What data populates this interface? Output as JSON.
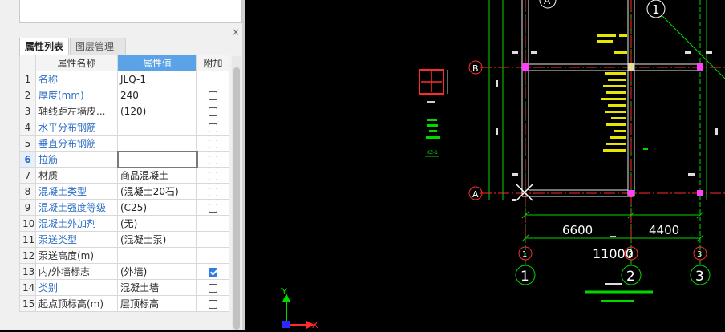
{
  "panel": {
    "close_icon": "×",
    "tabs": [
      {
        "label": "属性列表",
        "active": true
      },
      {
        "label": "图层管理",
        "active": false
      }
    ]
  },
  "table": {
    "headers": {
      "name": "属性名称",
      "value": "属性值",
      "extra": "附加"
    },
    "rows": [
      {
        "num": "1",
        "name": "名称",
        "value": "JLQ-1",
        "blue": true,
        "check": null
      },
      {
        "num": "2",
        "name": "厚度(mm)",
        "value": "240",
        "blue": true,
        "check": false
      },
      {
        "num": "3",
        "name": "轴线距左墙皮...",
        "value": "(120)",
        "blue": false,
        "check": false
      },
      {
        "num": "4",
        "name": "水平分布钢筋",
        "value": "",
        "blue": true,
        "check": false
      },
      {
        "num": "5",
        "name": "垂直分布钢筋",
        "value": "",
        "blue": true,
        "check": false
      },
      {
        "num": "6",
        "name": "拉筋",
        "value": "",
        "blue": true,
        "check": false,
        "selected": true
      },
      {
        "num": "7",
        "name": "材质",
        "value": "商品混凝土",
        "blue": false,
        "check": false
      },
      {
        "num": "8",
        "name": "混凝土类型",
        "value": "(混凝土20石)",
        "blue": true,
        "check": false
      },
      {
        "num": "9",
        "name": "混凝土强度等级",
        "value": "(C25)",
        "blue": true,
        "check": false
      },
      {
        "num": "10",
        "name": "混凝土外加剂",
        "value": "(无)",
        "blue": true,
        "check": null
      },
      {
        "num": "11",
        "name": "泵送类型",
        "value": "(混凝土泵)",
        "blue": true,
        "check": null
      },
      {
        "num": "12",
        "name": "泵送高度(m)",
        "value": "",
        "blue": false,
        "check": null
      },
      {
        "num": "13",
        "name": "内/外墙标志",
        "value": "(外墙)",
        "blue": false,
        "check": true
      },
      {
        "num": "14",
        "name": "类别",
        "value": "混凝土墙",
        "blue": true,
        "check": false
      },
      {
        "num": "15",
        "name": "起点顶标高(m)",
        "value": "层顶标高",
        "blue": false,
        "check": false
      }
    ]
  },
  "cad": {
    "colors": {
      "axis": "#ff2a2a",
      "grid": "#00d800",
      "text": "#ffffff",
      "wall": "#e8e8e8",
      "note": "#e6e600"
    },
    "axis_labels": {
      "top_a": "A",
      "top_1": "1",
      "row_b": "B",
      "row_a": "A",
      "col_1": "1",
      "col_2": "2",
      "col_3": "3"
    },
    "dims": {
      "d1": "6600",
      "d2": "4400",
      "total": "11000"
    },
    "legend": {
      "label": "KZ-1"
    },
    "ucs": {
      "y": "Y",
      "x": "X"
    }
  }
}
